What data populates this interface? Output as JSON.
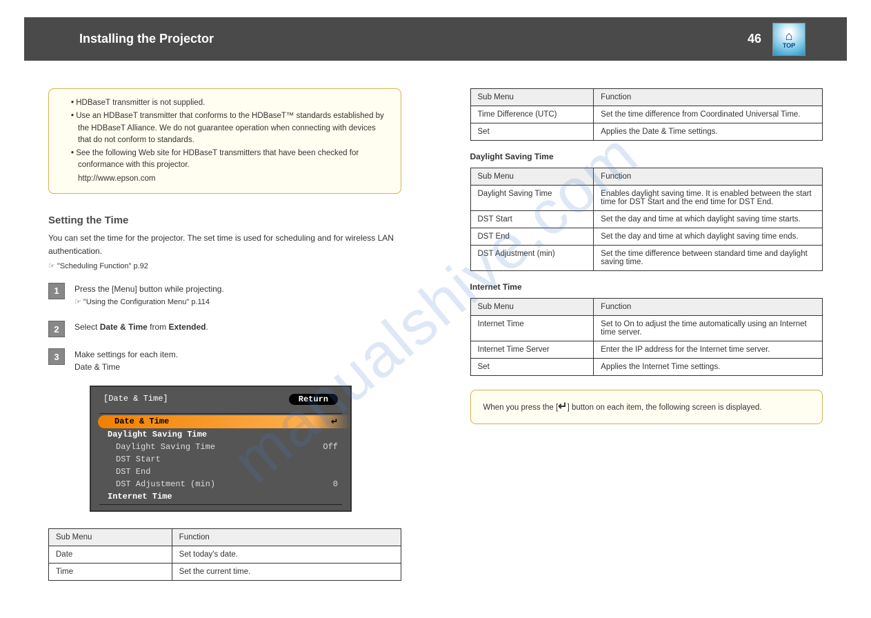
{
  "watermark": "manualshive.com",
  "header": {
    "title": "Installing the Projector",
    "page": "46",
    "top_label": "TOP"
  },
  "left": {
    "note_items": [
      "HDBaseT transmitter is not supplied.",
      "Use an HDBaseT transmitter that conforms to the HDBaseT™ standards established by the HDBaseT Alliance. We do not guarantee operation when connecting with devices that do not conform to standards.",
      "See the following Web site for HDBaseT transmitters that have been checked for conformance with this projector."
    ],
    "note_url": "http://www.epson.com",
    "h2": "Setting the Time",
    "p1": "You can set the time for the projector. The set time is used for scheduling and for wireless LAN authentication.",
    "ref1": "\"Scheduling Function\" p.92",
    "step1": "Press the [Menu] button while projecting.",
    "ref2": "\"Using the Configuration Menu\" p.114",
    "step2_a": "Select ",
    "step2_b": "Date & Time",
    "step2_c": " from ",
    "step2_d": "Extended",
    "step3_a": "Make settings for each item.",
    "menu": {
      "title": "[Date & Time]",
      "return": "Return",
      "item1": "Date & Time",
      "item2": "Daylight Saving Time",
      "sub1_label": "Daylight Saving Time",
      "sub1_val": "Off",
      "sub2": "DST Start",
      "sub3": "DST End",
      "sub4_label": "DST Adjustment (min)",
      "sub4_val": "0",
      "item3": "Internet Time"
    },
    "t_sub": "Sub Menu",
    "t_fn": "Function",
    "t1r1a": "Date",
    "t1r1b": "Set today's date.",
    "t1r2a": "Time",
    "t1r2b": "Set the current time."
  },
  "right": {
    "t_sub": "Sub Menu",
    "t_fn": "Function",
    "t2r1a": "Time Difference (UTC)",
    "t2r1b": "Set the time difference from Coordinated Universal Time.",
    "t2r2a": "Set",
    "t2r2b": "Applies the Date & Time settings.",
    "dst_head": "Daylight Saving Time",
    "t3r1a": "Daylight Saving Time",
    "t3r1b": "Enables daylight saving time. It is enabled between the start time for DST Start and the end time for DST End.",
    "t3r2a": "DST Start",
    "t3r2b": "Set the day and time at which daylight saving time starts.",
    "t3r3a": "DST End",
    "t3r3b": "Set the day and time at which daylight saving time ends.",
    "t3r4a": "DST Adjustment (min)",
    "t3r4b": "Set the time difference between standard time and daylight saving time.",
    "it_head": "Internet Time",
    "t4r1a": "Internet Time",
    "t4r1b": "Set to On to adjust the time automatically using an Internet time server.",
    "t4r2a": "Internet Time Server",
    "t4r2b": "Enter the IP address for the Internet time server.",
    "t4r3a": "Set",
    "t4r3b": "Applies the Internet Time settings.",
    "note2_a": "When you press the [",
    "note2_b": "] button on each item, the following screen is displayed."
  }
}
